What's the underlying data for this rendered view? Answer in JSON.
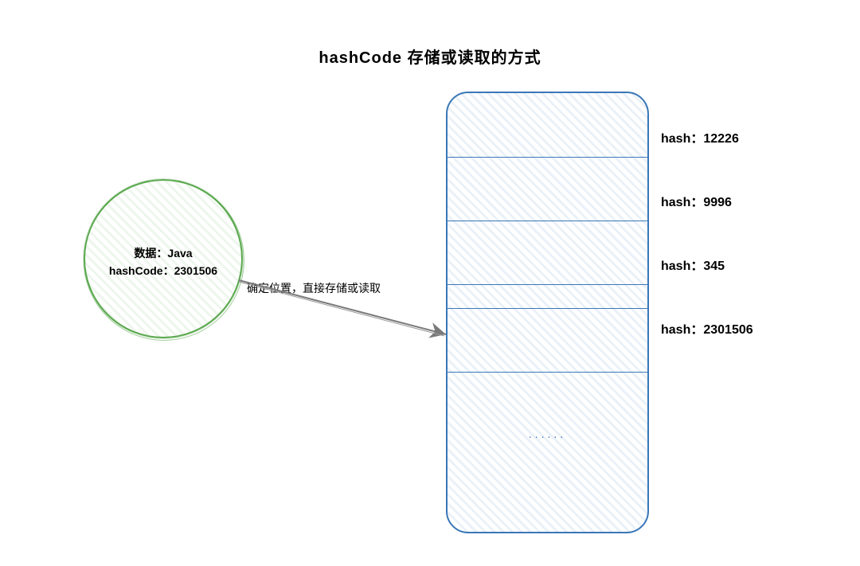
{
  "title": "hashCode 存储或读取的方式",
  "node": {
    "line1": "数据：Java",
    "line2": "hashCode：2301506"
  },
  "arrow_caption": "确定位置，直接存储或读取",
  "table": {
    "rows": [
      {
        "hash_label": "hash：12226"
      },
      {
        "hash_label": "hash：9996"
      },
      {
        "hash_label": "hash：345"
      },
      {
        "hash_label": "hash：2301506"
      }
    ],
    "ellipsis": "......"
  }
}
